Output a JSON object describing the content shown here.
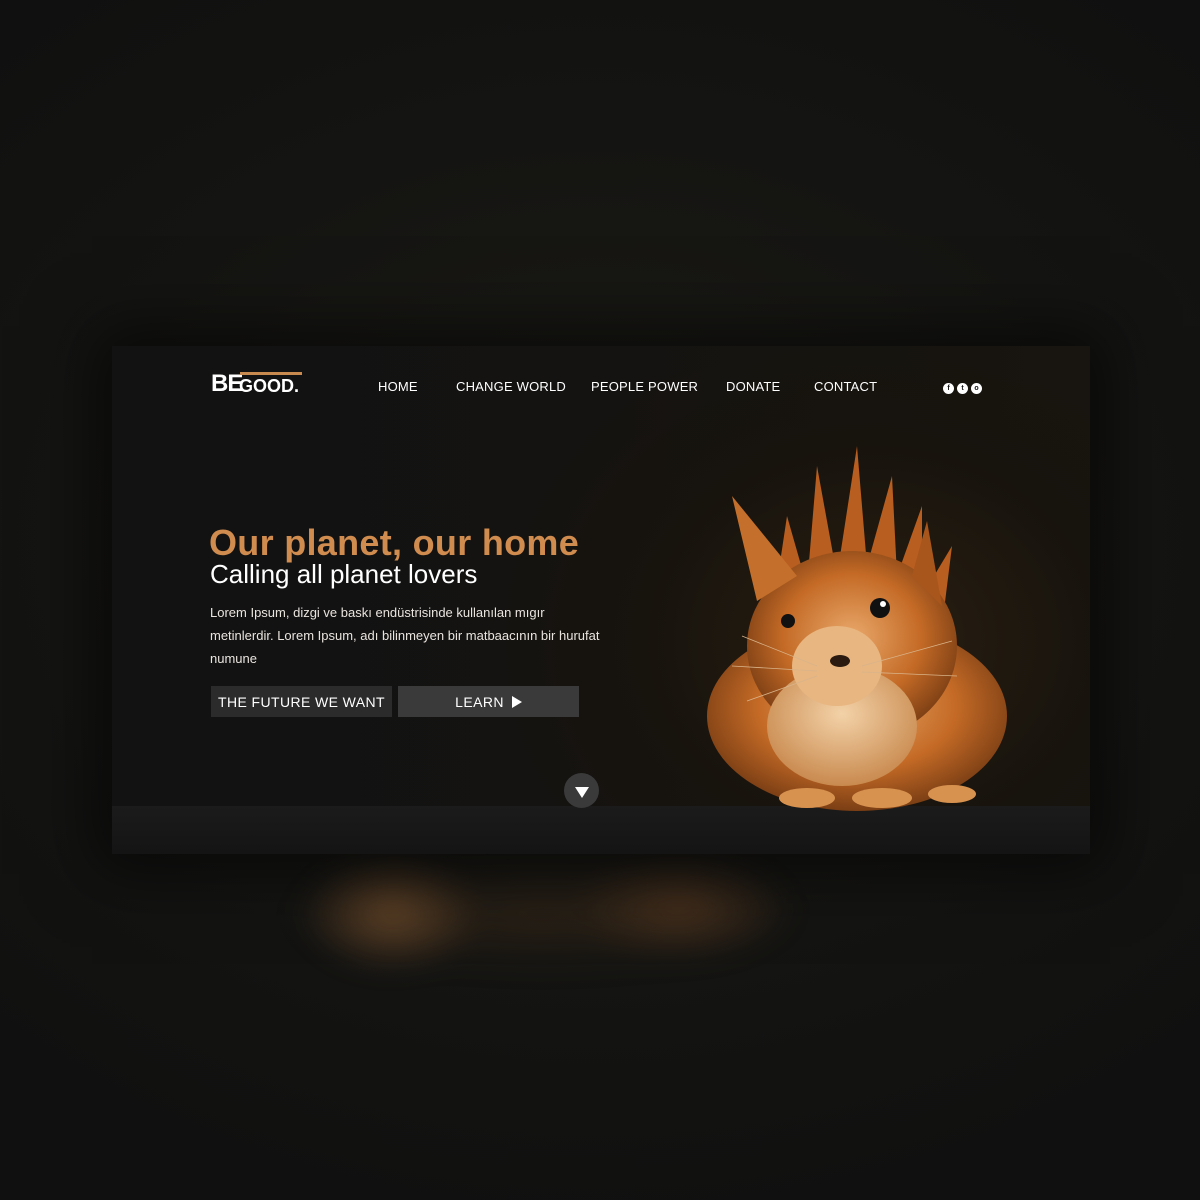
{
  "logo": {
    "be": "BE",
    "good": "GOOD."
  },
  "nav": {
    "items": [
      {
        "label": "HOME"
      },
      {
        "label": "CHANGE WORLD"
      },
      {
        "label": "PEOPLE POWER"
      },
      {
        "label": "DONATE"
      },
      {
        "label": "CONTACT"
      }
    ]
  },
  "social": {
    "icons": [
      {
        "name": "facebook-icon",
        "glyph": "f"
      },
      {
        "name": "twitter-icon",
        "glyph": "t"
      },
      {
        "name": "instagram-icon",
        "glyph": "o"
      }
    ]
  },
  "hero": {
    "headline": "Our planet, our home",
    "subheadline": "Calling all planet lovers",
    "body": "Lorem Ipsum, dizgi ve baskı endüstrisinde kullanılan mıgır metinlerdir. Lorem Ipsum, adı bilinmeyen bir matbaacının bir hurufat numune",
    "buttons": {
      "future": "THE FUTURE WE WANT",
      "learn": "LEARN"
    }
  },
  "colors": {
    "accent": "#d08b4e",
    "background": "#121212",
    "button_dark": "#2b2b2b",
    "button_light": "#3a3a3a"
  }
}
